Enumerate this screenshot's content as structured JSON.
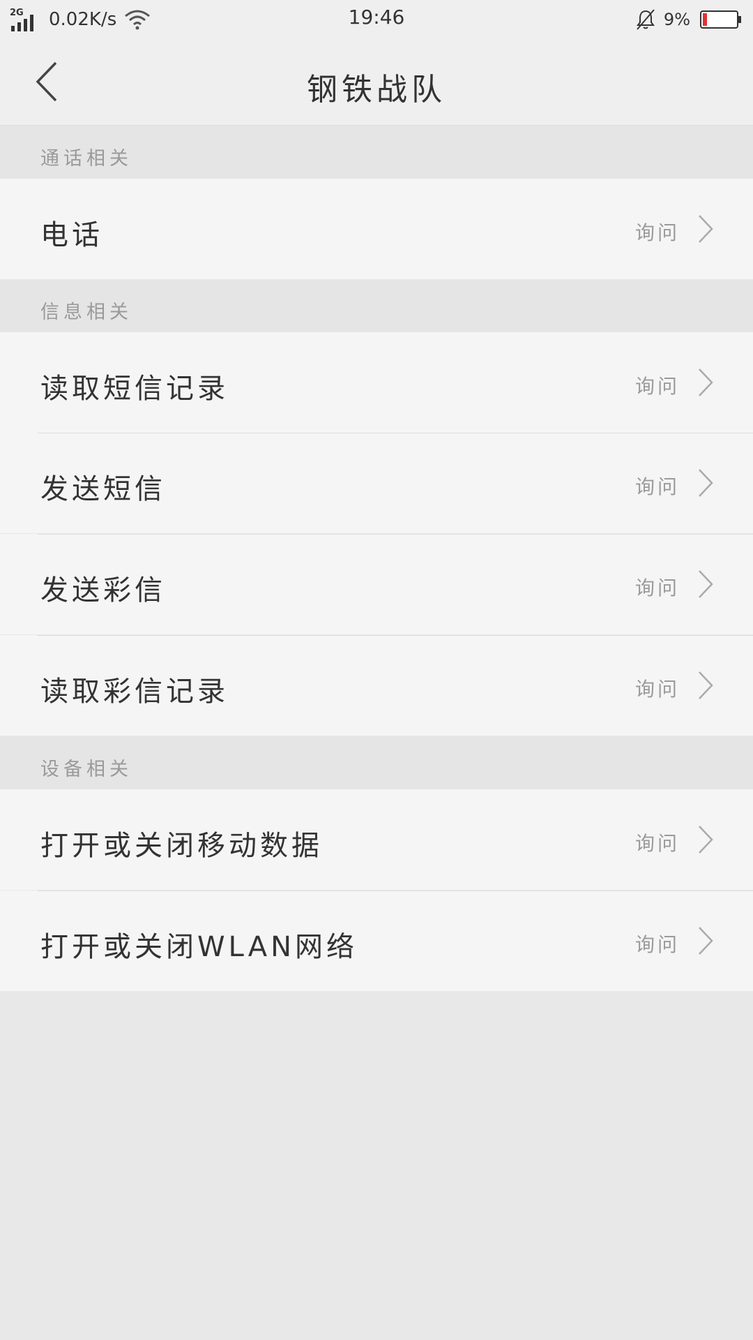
{
  "statusbar": {
    "network_type": "2G",
    "net_speed": "0.02K/s",
    "time": "19:46",
    "battery_percent": "9%",
    "battery_level": 0.09,
    "battery_color": "#e23333"
  },
  "header": {
    "title": "钢铁战队"
  },
  "sections": [
    {
      "title": "通话相关",
      "items": [
        {
          "label": "电话",
          "value": "询问"
        }
      ]
    },
    {
      "title": "信息相关",
      "items": [
        {
          "label": "读取短信记录",
          "value": "询问"
        },
        {
          "label": "发送短信",
          "value": "询问"
        },
        {
          "label": "发送彩信",
          "value": "询问"
        },
        {
          "label": "读取彩信记录",
          "value": "询问"
        }
      ]
    },
    {
      "title": "设备相关",
      "items": [
        {
          "label": "打开或关闭移动数据",
          "value": "询问"
        },
        {
          "label": "打开或关闭WLAN网络",
          "value": "询问"
        }
      ]
    }
  ]
}
